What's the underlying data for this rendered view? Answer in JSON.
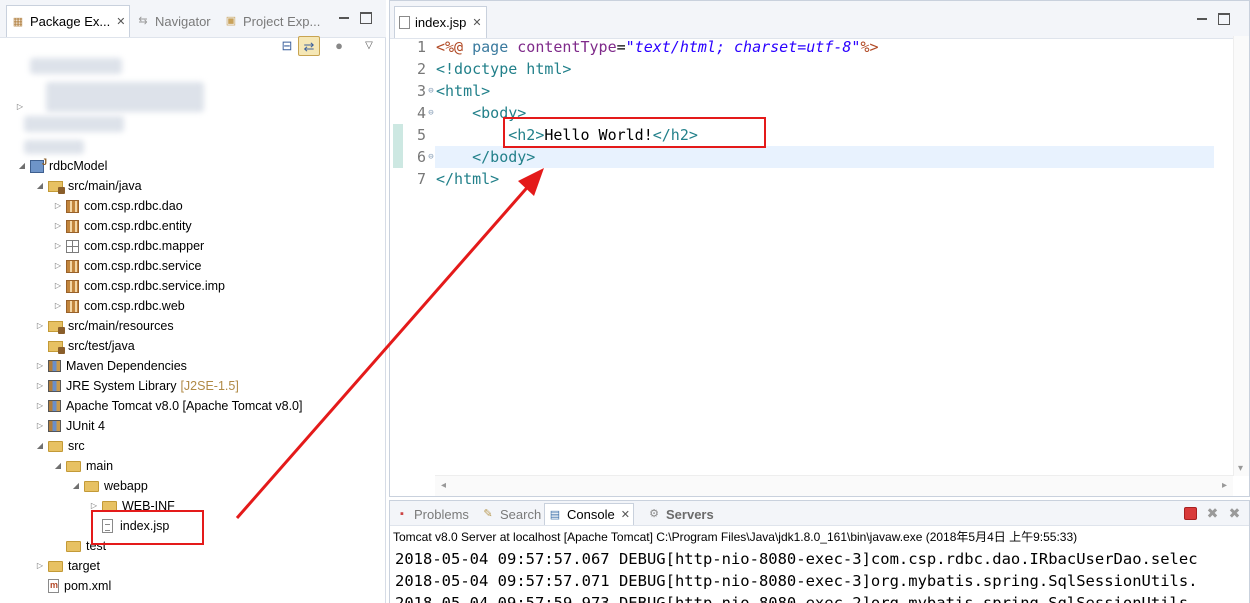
{
  "left_view": {
    "tabs": [
      {
        "label": "Package Ex...",
        "active": true,
        "icon": "package-explorer-icon"
      },
      {
        "label": "Navigator",
        "active": false,
        "icon": "navigator-icon"
      },
      {
        "label": "Project Exp...",
        "active": false,
        "icon": "project-explorer-icon"
      }
    ],
    "tree": [
      {
        "label": "rdbcModel",
        "icon": "project",
        "twisty": "open"
      },
      {
        "label": "src/main/java",
        "icon": "srcfolder",
        "twisty": "open"
      },
      {
        "label": "com.csp.rdbc.dao",
        "icon": "pkg",
        "twisty": "closed"
      },
      {
        "label": "com.csp.rdbc.entity",
        "icon": "pkg",
        "twisty": "closed"
      },
      {
        "label": "com.csp.rdbc.mapper",
        "icon": "pkg-empty",
        "twisty": "closed"
      },
      {
        "label": "com.csp.rdbc.service",
        "icon": "pkg",
        "twisty": "closed"
      },
      {
        "label": "com.csp.rdbc.service.imp",
        "icon": "pkg",
        "twisty": "closed"
      },
      {
        "label": "com.csp.rdbc.web",
        "icon": "pkg",
        "twisty": "closed"
      },
      {
        "label": "src/main/resources",
        "icon": "srcfolder",
        "twisty": "closed"
      },
      {
        "label": "src/test/java",
        "icon": "srcfolder",
        "twisty": "none"
      },
      {
        "label": "Maven Dependencies",
        "icon": "lib",
        "twisty": "closed"
      },
      {
        "label": "JRE System Library",
        "decoration": "[J2SE-1.5]",
        "icon": "lib",
        "twisty": "closed"
      },
      {
        "label": "Apache Tomcat v8.0 [Apache Tomcat v8.0]",
        "icon": "lib",
        "twisty": "closed"
      },
      {
        "label": "JUnit 4",
        "icon": "lib",
        "twisty": "closed"
      },
      {
        "label": "src",
        "icon": "folder",
        "twisty": "open"
      },
      {
        "label": "main",
        "icon": "folder",
        "twisty": "open"
      },
      {
        "label": "webapp",
        "icon": "folder",
        "twisty": "open"
      },
      {
        "label": "WEB-INF",
        "icon": "folder",
        "twisty": "closed"
      },
      {
        "label": "index.jsp",
        "icon": "file",
        "twisty": "none",
        "selected": true
      },
      {
        "label": "test",
        "icon": "folder",
        "twisty": "none"
      },
      {
        "label": "target",
        "icon": "folder",
        "twisty": "closed"
      },
      {
        "label": "pom.xml",
        "icon": "xml",
        "twisty": "none"
      }
    ]
  },
  "editor": {
    "tab_label": "index.jsp",
    "lines": [
      {
        "n": "1",
        "fold": "",
        "tokens": [
          {
            "c": "t-dir",
            "t": "<%@"
          },
          {
            "c": "t-txt",
            "t": " "
          },
          {
            "c": "t-kw",
            "t": "page"
          },
          {
            "c": "t-txt",
            "t": " "
          },
          {
            "c": "t-attr",
            "t": "contentType"
          },
          {
            "c": "t-txt",
            "t": "="
          },
          {
            "c": "t-str",
            "t": "\"text/html; charset=utf-8\""
          },
          {
            "c": "t-dir",
            "t": "%>"
          }
        ]
      },
      {
        "n": "2",
        "fold": "",
        "tokens": [
          {
            "c": "t-tag",
            "t": "<!doctype html>"
          }
        ]
      },
      {
        "n": "3",
        "fold": "⊖",
        "tokens": [
          {
            "c": "t-tag",
            "t": "<html>"
          }
        ]
      },
      {
        "n": "4",
        "fold": "⊖",
        "tokens": [
          {
            "c": "t-txt",
            "t": "    "
          },
          {
            "c": "t-tag",
            "t": "<body>"
          }
        ]
      },
      {
        "n": "5",
        "fold": "",
        "tokens": [
          {
            "c": "t-txt",
            "t": "        "
          },
          {
            "c": "t-tag",
            "t": "<h2>"
          },
          {
            "c": "t-txt",
            "t": "Hello World!"
          },
          {
            "c": "t-tag",
            "t": "</h2>"
          }
        ]
      },
      {
        "n": "6",
        "fold": "⊖",
        "tokens": [
          {
            "c": "t-txt",
            "t": "    "
          },
          {
            "c": "t-tag",
            "t": "</body>"
          }
        ]
      },
      {
        "n": "7",
        "fold": "",
        "tokens": [
          {
            "c": "t-tag",
            "t": "</html>"
          }
        ]
      }
    ]
  },
  "console_view": {
    "tabs": [
      {
        "label": "Problems",
        "active": false,
        "icon": "problems-icon"
      },
      {
        "label": "Search",
        "active": false,
        "icon": "search-icon"
      },
      {
        "label": "Console",
        "active": true,
        "icon": "console-icon"
      },
      {
        "label": "Servers",
        "active": false,
        "icon": "servers-icon"
      }
    ],
    "description": "Tomcat v8.0 Server at localhost [Apache Tomcat] C:\\Program Files\\Java\\jdk1.8.0_161\\bin\\javaw.exe (2018年5月4日 上午9:55:33)",
    "lines": [
      "2018-05-04 09:57:57.067 DEBUG[http-nio-8080-exec-3]com.csp.rdbc.dao.IRbacUserDao.selec",
      "2018-05-04 09:57:57.071 DEBUG[http-nio-8080-exec-3]org.mybatis.spring.SqlSessionUtils.",
      "2018-05-04 09:57:59.973 DEBUG[http-nio-8080-exec-2]org.mybatis.spring.SqlSessionUtils."
    ]
  },
  "colors": {
    "annotation_red": "#e41a1a",
    "current_line": "#e8f2fe",
    "tag": "#22808a",
    "directive": "#b14a25",
    "string": "#2a00ff"
  }
}
